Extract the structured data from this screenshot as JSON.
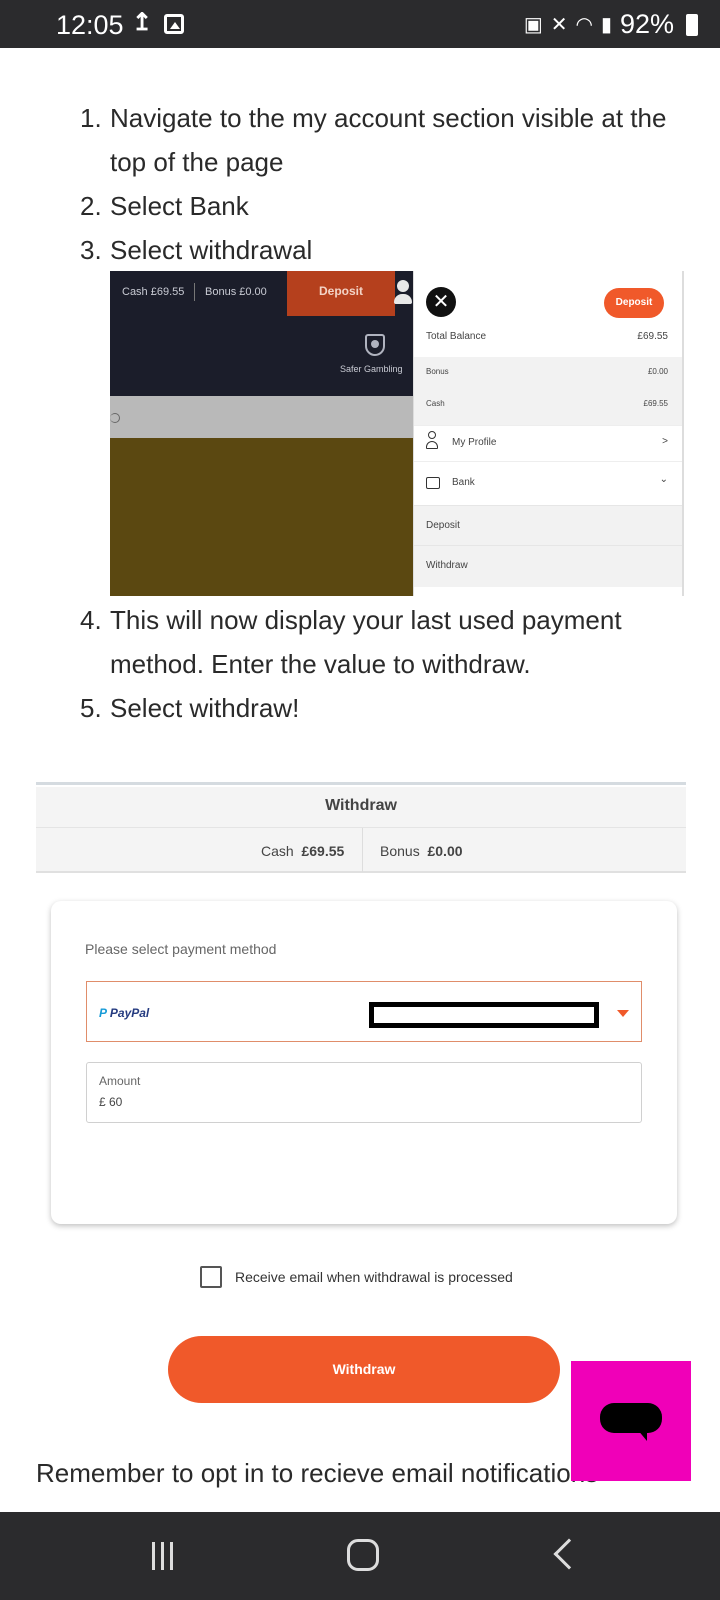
{
  "status_bar": {
    "time": "12:05",
    "battery": "92%",
    "icons": [
      "upload-icon",
      "gallery-icon",
      "data-saver-icon",
      "mute-icon",
      "wifi-icon",
      "signal-icon",
      "battery-icon"
    ]
  },
  "steps_part1": [
    {
      "num": "1.",
      "text": "Navigate to the my account section visible at the top of the page"
    },
    {
      "num": "2.",
      "text": "Select Bank"
    },
    {
      "num": "3.",
      "text": "Select withdrawal"
    }
  ],
  "screenshot1": {
    "topbar": {
      "cash": "Cash  £69.55",
      "bonus": "Bonus  £0.00",
      "deposit": "Deposit"
    },
    "safer_gambling": "Safer Gambling",
    "panel": {
      "deposit_button": "Deposit",
      "total_balance_label": "Total Balance",
      "total_balance_value": "£69.55",
      "bonus_label": "Bonus",
      "bonus_value": "£0.00",
      "cash_label": "Cash",
      "cash_value": "£69.55",
      "my_profile": "My Profile",
      "profile_chevron": ">",
      "bank": "Bank",
      "bank_chevron": "⌄",
      "deposit_item": "Deposit",
      "withdraw_item": "Withdraw"
    }
  },
  "steps_part2": [
    {
      "num": "4.",
      "text": "This will now display your last used payment method. Enter the value to withdraw."
    },
    {
      "num": "5.",
      "text": "Select withdraw!"
    }
  ],
  "screenshot2": {
    "title": "Withdraw",
    "cash_label": "Cash",
    "cash_value": "£69.55",
    "bonus_label": "Bonus",
    "bonus_value": "£0.00",
    "payment_method_label": "Please select payment method",
    "payment_method_value": "PayPal",
    "amount_label": "Amount",
    "amount_value": "£ 60",
    "email_checkbox_label": "Receive email when withdrawal is processed",
    "email_checkbox_checked": false,
    "withdraw_button": "Withdraw",
    "accent_color": "#f0592a"
  },
  "remember_text": "Remember to opt in to recieve email notifications",
  "chat_button_color": "#f000b8"
}
